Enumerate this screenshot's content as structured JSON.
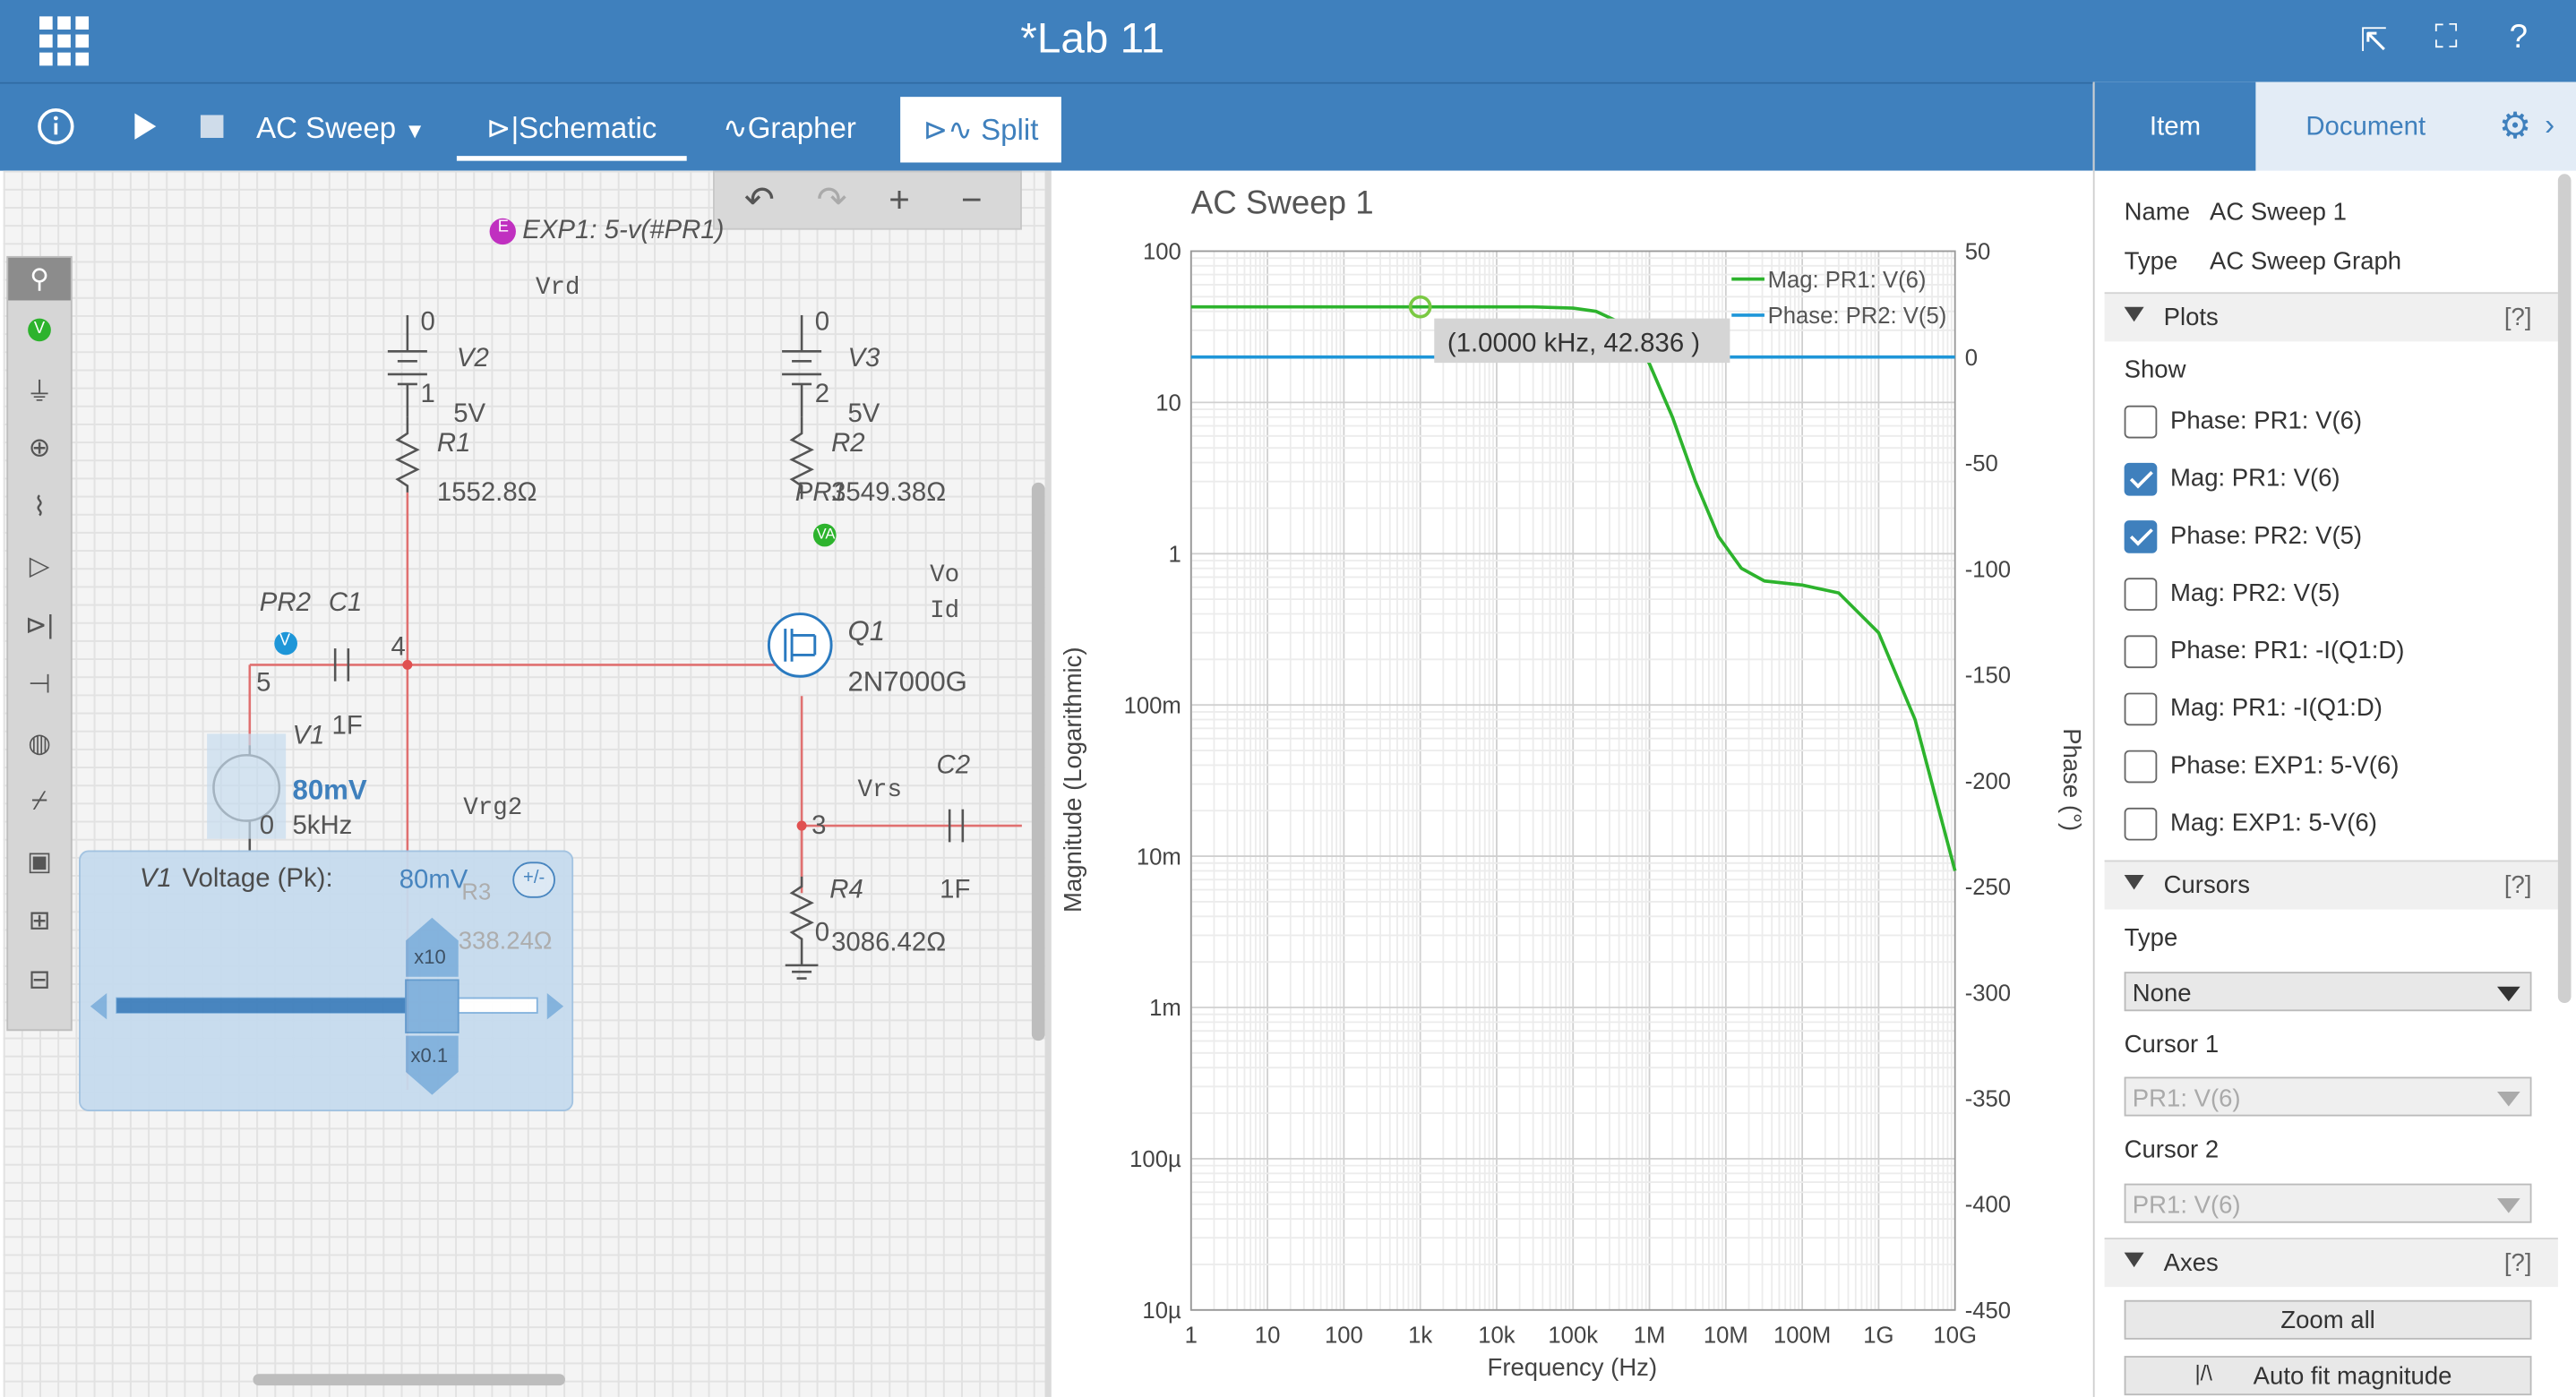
{
  "app": {
    "title": "*Lab 11"
  },
  "toolbar": {
    "analysis_mode": "AC Sweep",
    "tab_schematic": "Schematic",
    "tab_grapher": "Grapher",
    "tab_split": "Split"
  },
  "schematic": {
    "expression_probe": "EXP1: 5-v(#PR1)",
    "net_labels": {
      "vrd": "Vrd",
      "vrg2": "Vrg2",
      "vo": "Vo",
      "id": "Id",
      "vrs": "Vrs"
    },
    "nodes": {
      "n0a": "0",
      "n1": "1",
      "n0b": "0",
      "n2": "2",
      "n4": "4",
      "n5": "5",
      "n3": "3",
      "n0c": "0",
      "n0d": "0"
    },
    "v2": {
      "name": "V2",
      "value": "5V"
    },
    "v3": {
      "name": "V3",
      "value": "5V"
    },
    "r1": {
      "name": "R1",
      "value": "1552.8Ω"
    },
    "r2": {
      "name": "R2",
      "value": "3549.38Ω"
    },
    "pr1": "PR1",
    "pr2": "PR2",
    "c1": {
      "name": "C1",
      "value": "1F"
    },
    "c2": {
      "name": "C2",
      "value": "1F"
    },
    "q1": {
      "name": "Q1",
      "model": "2N7000G"
    },
    "v1": {
      "name": "V1",
      "amplitude": "80mV",
      "frequency": "5kHz"
    },
    "r4": {
      "name": "R4",
      "value": "3086.42Ω"
    },
    "r3_partial": {
      "name": "R3",
      "value": "338.24Ω"
    },
    "voltage_panel": {
      "label_name": "V1",
      "label": "Voltage (Pk):",
      "value": "80mV",
      "plus_minus": "+/-",
      "x10": "x10",
      "x01": "x0.1"
    }
  },
  "graph": {
    "title": "AC Sweep 1",
    "cursor_readout": "(1.0000 kHz, 42.836 )",
    "legend": [
      "Mag: PR1: V(6)",
      "Phase: PR2: V(5)"
    ],
    "colors": {
      "mag": "#2db32d",
      "phase": "#1e96d8"
    }
  },
  "chart_data": {
    "type": "line",
    "title": "AC Sweep 1",
    "xlabel": "Frequency (Hz)",
    "ylabel": "Magnitude (Logarithmic)",
    "y2label": "Phase (°)",
    "x_scale": "log",
    "y_scale": "log",
    "xlim": [
      1,
      10000000000
    ],
    "ylim": [
      1e-05,
      100
    ],
    "y2lim": [
      -450,
      50
    ],
    "x_ticks": [
      "1",
      "10",
      "100",
      "1k",
      "10k",
      "100k",
      "1M",
      "10M",
      "100M",
      "1G",
      "10G"
    ],
    "y_ticks": [
      "100",
      "10",
      "1",
      "100m",
      "10m",
      "1m",
      "100µ",
      "10µ"
    ],
    "y2_ticks": [
      "50",
      "0",
      "-50",
      "-100",
      "-150",
      "-200",
      "-250",
      "-300",
      "-350",
      "-400",
      "-450"
    ],
    "grid": true,
    "legend_position": "top-right",
    "series": [
      {
        "name": "Mag: PR1: V(6)",
        "axis": "left",
        "x": [
          1,
          10,
          100,
          1000,
          10000,
          30000,
          100000,
          200000,
          400000,
          700000,
          1000000,
          2000000,
          4000000,
          8000000,
          16000000,
          32000000,
          100000000,
          300000000,
          1000000000,
          3000000000,
          10000000000
        ],
        "y": [
          42.836,
          42.836,
          42.836,
          42.836,
          42.836,
          42.8,
          42.0,
          40.0,
          34.0,
          25.0,
          18.0,
          8.0,
          3.0,
          1.3,
          0.8,
          0.66,
          0.62,
          0.55,
          0.3,
          0.08,
          0.008
        ]
      },
      {
        "name": "Phase: PR2: V(5)",
        "axis": "right",
        "x": [
          1,
          10000000000
        ],
        "y": [
          0,
          0
        ]
      }
    ],
    "cursor_point": {
      "x": 1000,
      "y": 42.836
    }
  },
  "right_panel": {
    "tab_item": "Item",
    "tab_document": "Document",
    "name_label": "Name",
    "name_value": "AC Sweep 1",
    "type_label": "Type",
    "type_value": "AC Sweep Graph",
    "plots_section": "Plots",
    "help": "[?]",
    "show_label": "Show",
    "plots": [
      {
        "label": "Phase: PR1: V(6)",
        "checked": false
      },
      {
        "label": "Mag: PR1: V(6)",
        "checked": true
      },
      {
        "label": "Phase: PR2: V(5)",
        "checked": true
      },
      {
        "label": "Mag: PR2: V(5)",
        "checked": false
      },
      {
        "label": "Phase: PR1: -I(Q1:D)",
        "checked": false
      },
      {
        "label": "Mag: PR1: -I(Q1:D)",
        "checked": false
      },
      {
        "label": "Phase: EXP1: 5-V(6)",
        "checked": false
      },
      {
        "label": "Mag: EXP1: 5-V(6)",
        "checked": false
      }
    ],
    "cursors_section": "Cursors",
    "type2_label": "Type",
    "cursor_type": "None",
    "cursor1_label": "Cursor 1",
    "cursor1_value": "PR1: V(6)",
    "cursor2_label": "Cursor 2",
    "cursor2_value": "PR1: V(6)",
    "axes_section": "Axes",
    "zoom_all": "Zoom all",
    "auto_fit": "Auto fit magnitude"
  }
}
